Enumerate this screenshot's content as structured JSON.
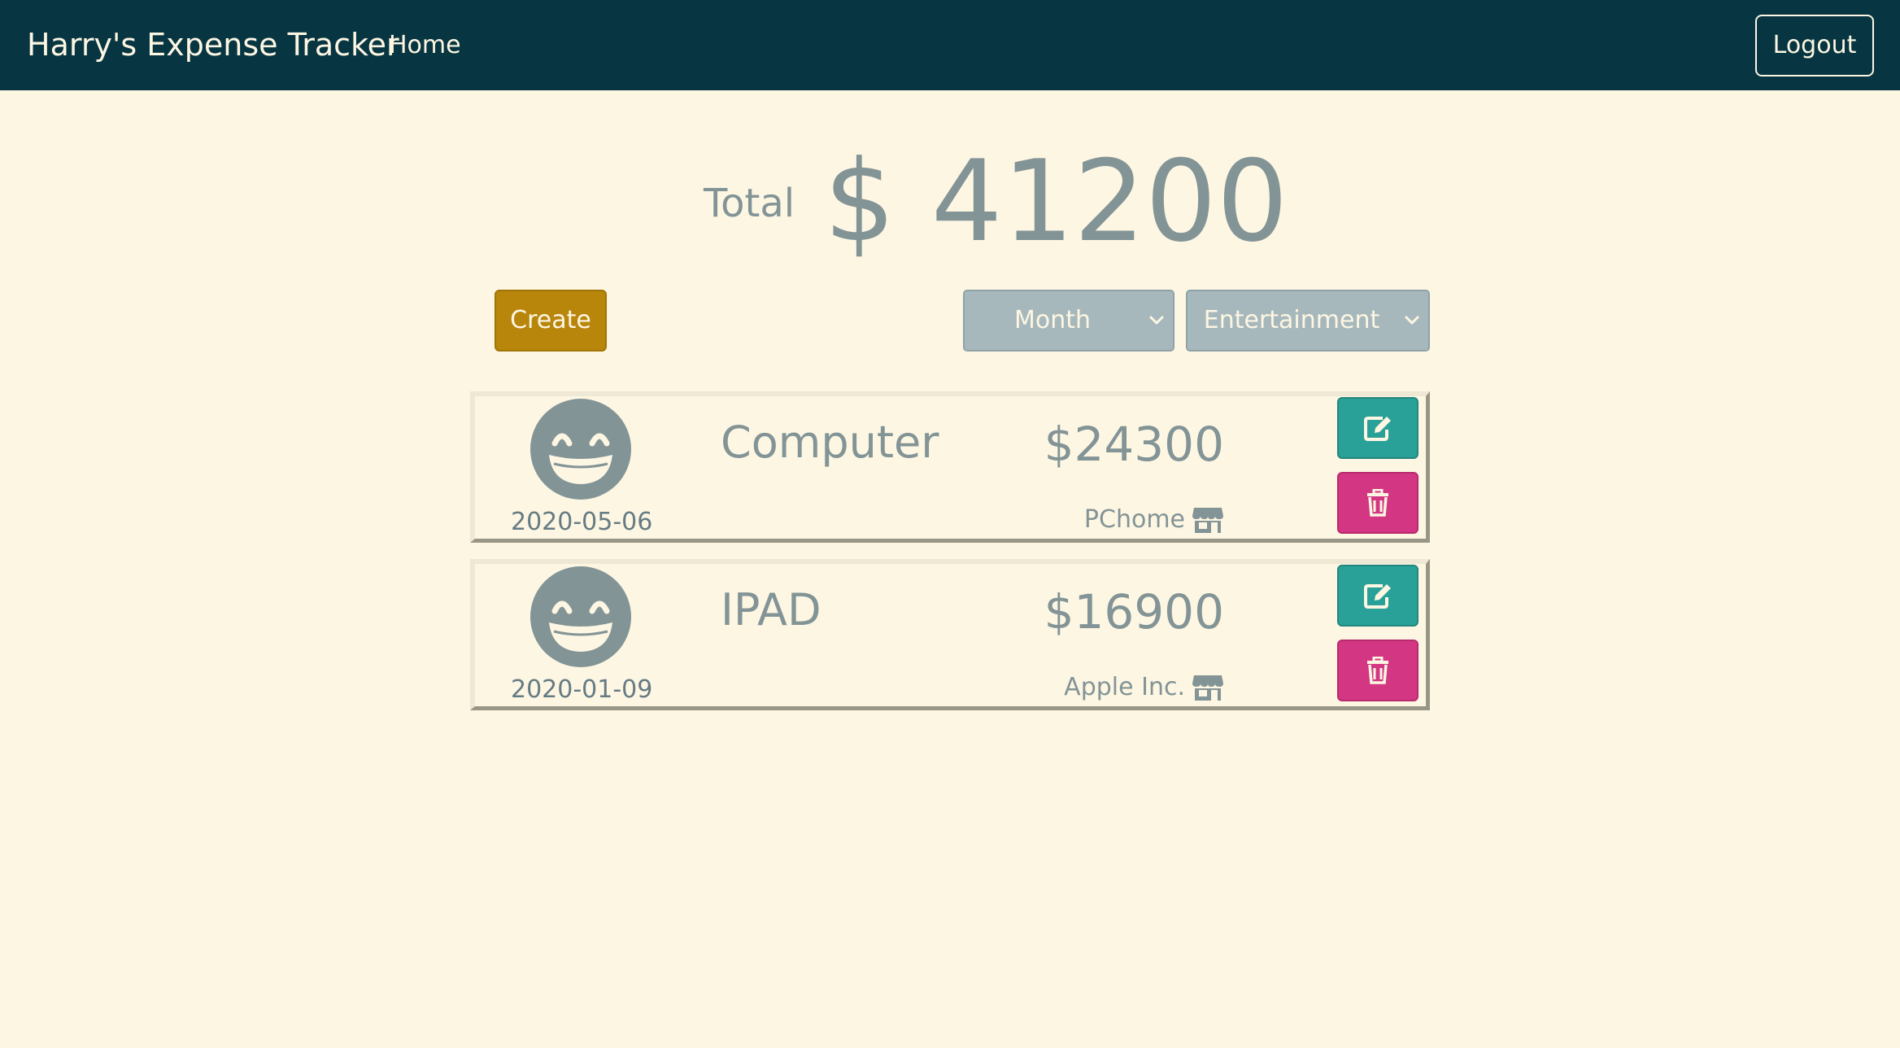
{
  "navbar": {
    "brand": "Harry's Expense Tracker",
    "home_label": "Home",
    "logout_label": "Logout"
  },
  "summary": {
    "total_label": "Total",
    "total_value": "$ 41200"
  },
  "controls": {
    "create_label": "Create",
    "period_select": "Month",
    "category_select": "Entertainment"
  },
  "records": [
    {
      "icon": "grin-beam-icon",
      "date": "2020-05-06",
      "name": "Computer",
      "amount": "$24300",
      "merchant": "PChome"
    },
    {
      "icon": "grin-beam-icon",
      "date": "2020-01-09",
      "name": "IPAD",
      "amount": "$16900",
      "merchant": "Apple Inc."
    }
  ],
  "colors": {
    "navbar_bg": "#073642",
    "page_bg": "#fdf6e3",
    "text": "#839496",
    "create_btn": "#b8860b",
    "select_bg": "#a7b8bc",
    "edit_btn": "#2aa198",
    "delete_btn": "#d33682"
  }
}
